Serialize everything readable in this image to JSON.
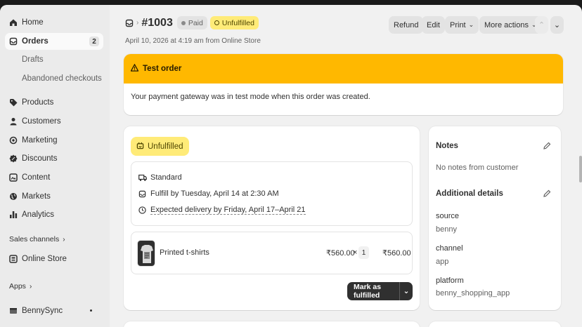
{
  "sidebar": {
    "items": [
      {
        "label": "Home",
        "icon": "home-icon"
      },
      {
        "label": "Orders",
        "icon": "orders-icon",
        "badge": "2",
        "active": true
      },
      {
        "label": "Drafts"
      },
      {
        "label": "Abandoned checkouts"
      },
      {
        "label": "Products",
        "icon": "tag-icon"
      },
      {
        "label": "Customers",
        "icon": "person-icon"
      },
      {
        "label": "Marketing",
        "icon": "target-icon"
      },
      {
        "label": "Discounts",
        "icon": "discount-icon"
      },
      {
        "label": "Content",
        "icon": "content-icon"
      },
      {
        "label": "Markets",
        "icon": "globe-icon"
      },
      {
        "label": "Analytics",
        "icon": "bar-chart-icon"
      }
    ],
    "sales_channels": "Sales channels",
    "online_store": "Online Store",
    "apps": "Apps",
    "benny_sync": "BennySync"
  },
  "header": {
    "order_number": "#1003",
    "paid_badge": "Paid",
    "unfulfilled_badge": "Unfulfilled",
    "subtitle": "April 10, 2026 at 4:19 am from Online Store",
    "refund": "Refund",
    "edit": "Edit",
    "print": "Print",
    "more_actions": "More actions"
  },
  "banner": {
    "title": "Test order",
    "body": "Your payment gateway was in test mode when this order was created."
  },
  "fulfillment": {
    "status": "Unfulfilled",
    "shipping_method": "Standard",
    "fulfill_by": "Fulfill by Tuesday, April 14 at 2:30 AM",
    "expected_delivery": "Expected delivery by Friday, April 17–April 21",
    "product_name": "Printed t-shirts",
    "unit_price": "₹560.00",
    "multiply": "×",
    "quantity": "1",
    "total": "₹560.00",
    "mark_button": "Mark as fulfilled"
  },
  "notes": {
    "title": "Notes",
    "empty": "No notes from customer"
  },
  "additional": {
    "title": "Additional details",
    "fields": [
      {
        "label": "source",
        "value": "benny"
      },
      {
        "label": "channel",
        "value": "app"
      },
      {
        "label": "platform",
        "value": "benny_shopping_app"
      }
    ]
  },
  "colors": {
    "banner_bg": "#ffb800",
    "unfulfilled_bg": "#ffeb78",
    "primary_button": "#303030"
  }
}
